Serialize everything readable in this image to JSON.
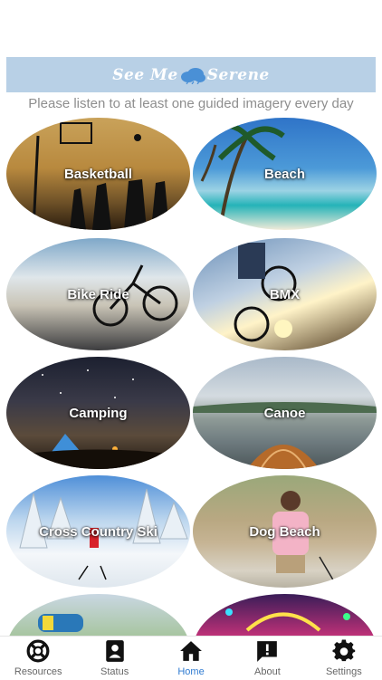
{
  "header": {
    "title_left": "See Me",
    "title_right": "Serene",
    "subtitle": "Please listen to at least one guided imagery every day"
  },
  "tiles": [
    {
      "label": "Basketball"
    },
    {
      "label": "Beach"
    },
    {
      "label": "Bike Ride"
    },
    {
      "label": "BMX"
    },
    {
      "label": "Camping"
    },
    {
      "label": "Canoe"
    },
    {
      "label": "Cross Country Ski"
    },
    {
      "label": "Dog Beach"
    },
    {
      "label": ""
    },
    {
      "label": ""
    }
  ],
  "tabs": [
    {
      "label": "Resources",
      "icon": "lifebuoy-icon"
    },
    {
      "label": "Status",
      "icon": "contact-card-icon"
    },
    {
      "label": "Home",
      "icon": "home-icon",
      "active": true
    },
    {
      "label": "About",
      "icon": "info-icon"
    },
    {
      "label": "Settings",
      "icon": "gear-icon"
    }
  ],
  "colors": {
    "banner": "#b8d0e6",
    "active_tab": "#2f7bd1",
    "inactive_tab": "#666666"
  }
}
